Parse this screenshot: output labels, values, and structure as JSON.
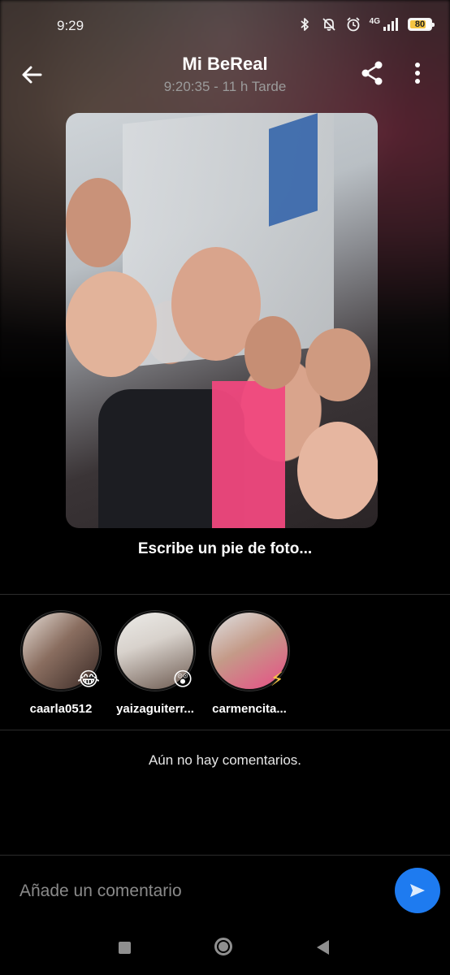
{
  "status_bar": {
    "time": "9:29",
    "network": "4G",
    "battery": "80",
    "battery_level": 0.8,
    "icons": [
      "bluetooth-icon",
      "mute-icon",
      "alarm-icon",
      "signal-icon",
      "battery-icon"
    ]
  },
  "header": {
    "title": "Mi BeReal",
    "subtitle": "9:20:35 - 11 h Tarde",
    "icons": [
      "back-arrow-icon",
      "share-icon",
      "more-vertical-icon"
    ]
  },
  "photo": {
    "content": "selfie-photo"
  },
  "caption_prompt": "Escribe un pie de foto...",
  "reactions": [
    {
      "username": "caarla0512",
      "emoji": "😂",
      "avatar_colors": [
        "#5a4a45",
        "#c9a58f"
      ]
    },
    {
      "username": "yaizaguiterr...",
      "emoji": "😲",
      "avatar_colors": [
        "#e8e4df",
        "#7a6659"
      ]
    },
    {
      "username": "carmencita...",
      "emoji": "⚡",
      "avatar_colors": [
        "#d9dbdd",
        "#e84d86"
      ]
    }
  ],
  "comments": {
    "empty_text": "Aún no hay comentarios."
  },
  "comment_bar": {
    "placeholder": "Añade un comentario",
    "value": ""
  },
  "colors": {
    "background": "#000000",
    "accent": "#1e7bf0",
    "subtitle": "#9b9b9b",
    "battery": "#f5c542"
  }
}
